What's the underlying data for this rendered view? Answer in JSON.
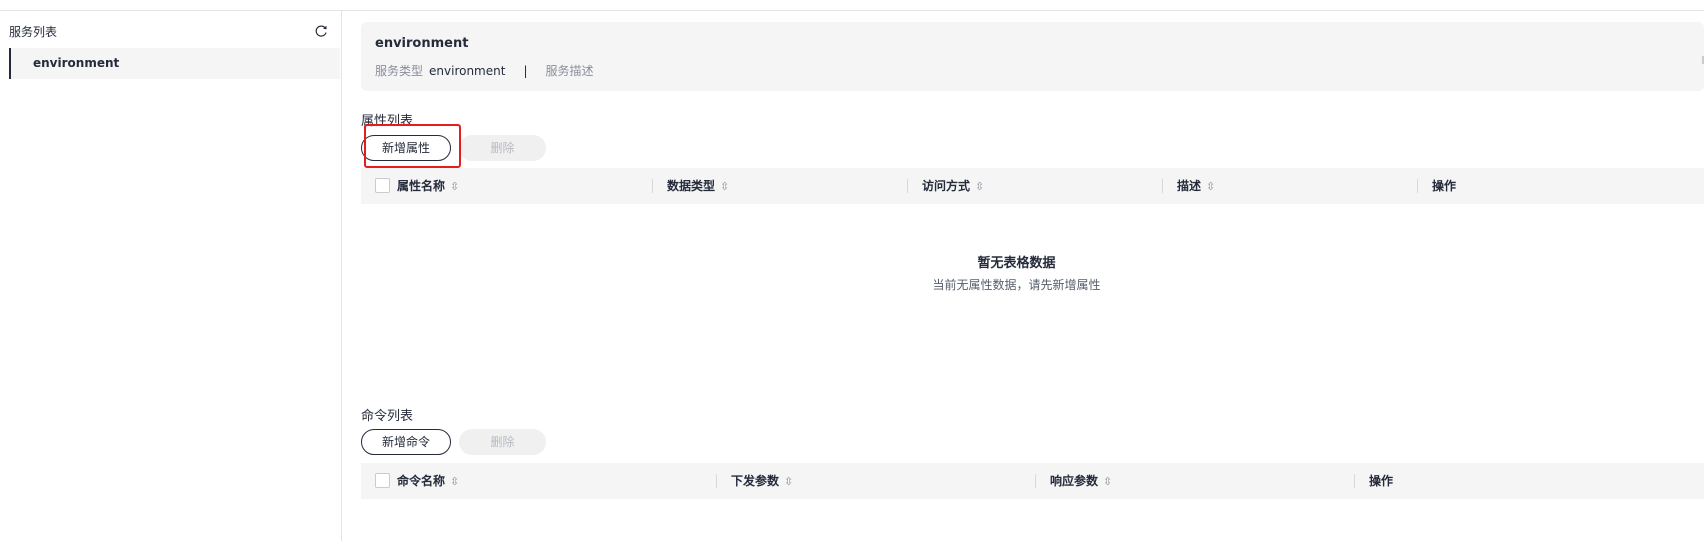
{
  "sidebar": {
    "title": "服务列表",
    "items": [
      {
        "label": "environment",
        "selected": true
      }
    ]
  },
  "service": {
    "name": "environment",
    "type_label": "服务类型",
    "type_value": "environment",
    "separator": "|",
    "desc_label": "服务描述"
  },
  "properties": {
    "title": "属性列表",
    "add_label": "新增属性",
    "delete_label": "删除",
    "columns": [
      "属性名称",
      "数据类型",
      "访问方式",
      "描述",
      "操作"
    ],
    "empty_title": "暂无表格数据",
    "empty_desc": "当前无属性数据，请先新增属性"
  },
  "commands": {
    "title": "命令列表",
    "add_label": "新增命令",
    "delete_label": "删除",
    "columns": [
      "命令名称",
      "下发参数",
      "响应参数",
      "操作"
    ]
  },
  "colors": {
    "highlight": "#e81c1c",
    "text": "#252b3a",
    "panel_bg": "#f5f5f6"
  }
}
